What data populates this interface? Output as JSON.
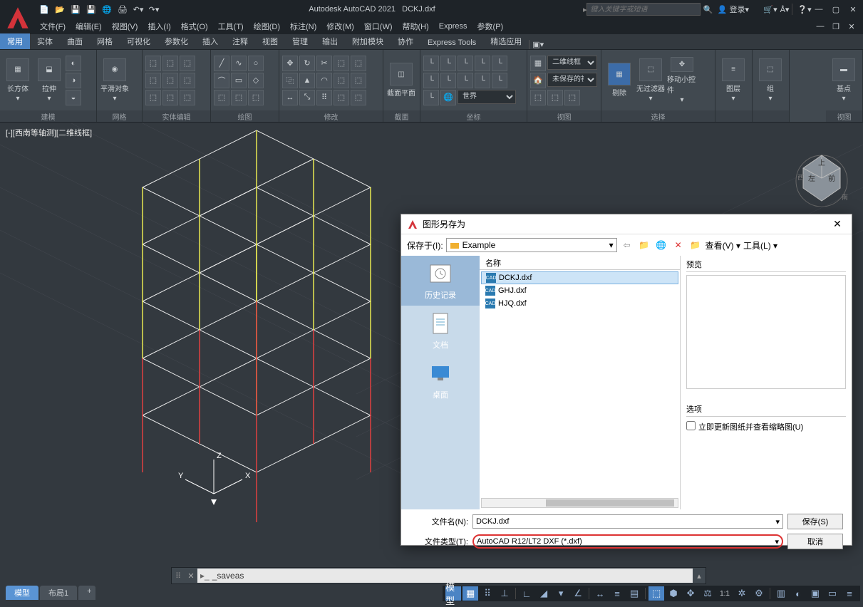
{
  "app": {
    "title_prefix": "Autodesk AutoCAD 2021",
    "document": "DCKJ.dxf",
    "search_placeholder": "键入关键字或短语",
    "login": "登录"
  },
  "menus": [
    "文件(F)",
    "编辑(E)",
    "视图(V)",
    "插入(I)",
    "格式(O)",
    "工具(T)",
    "绘图(D)",
    "标注(N)",
    "修改(M)",
    "窗口(W)",
    "帮助(H)",
    "Express",
    "参数(P)"
  ],
  "ribbon_tabs": [
    "常用",
    "实体",
    "曲面",
    "网格",
    "可视化",
    "参数化",
    "插入",
    "注释",
    "视图",
    "管理",
    "输出",
    "附加模块",
    "协作",
    "Express Tools",
    "精选应用"
  ],
  "ribbon_panels": {
    "p0": {
      "title": "建模",
      "btn0": "长方体",
      "btn1": "拉伸"
    },
    "p1": {
      "title": "网格",
      "btn0": "平滑对象"
    },
    "p2": {
      "title": "实体编辑"
    },
    "p3": {
      "title": "绘图"
    },
    "p4": {
      "title": "修改"
    },
    "p5": {
      "title": "截面",
      "btn0": "截面平面"
    },
    "p6": {
      "title": "坐标",
      "world": "世界"
    },
    "p7": {
      "title": "视图",
      "sel0": "二维线框",
      "sel1": "未保存的视图"
    },
    "p8": {
      "title": "选择",
      "btn0": "剔除",
      "btn1": "无过滤器",
      "btn2": "移动小控件"
    },
    "p9": {
      "btn": "图层"
    },
    "p10": {
      "btn": "组"
    },
    "p11": {
      "title": "视图",
      "btn": "基点"
    }
  },
  "viewport": {
    "label": "[-][西南等轴测][二维线框]",
    "axes": {
      "x": "X",
      "y": "Y",
      "z": "Z"
    },
    "cube": {
      "top": "上",
      "left": "左",
      "front": "前",
      "w": "西",
      "s": "南"
    }
  },
  "command": {
    "text": "_saveas"
  },
  "bottom_tabs": {
    "model": "模型",
    "layout1": "布局1",
    "add": "+"
  },
  "statusbar": {
    "model": "模型",
    "ratio": "1:1"
  },
  "dialog": {
    "title": "图形另存为",
    "save_in_label": "保存于(I):",
    "save_in_value": "Example",
    "view_btn": "查看(V)",
    "tools_btn": "工具(L)",
    "sidebar": {
      "history": "历史记录",
      "docs": "文档",
      "desktop": "桌面"
    },
    "col_name": "名称",
    "files": [
      "DCKJ.dxf",
      "GHJ.dxf",
      "HJQ.dxf"
    ],
    "preview_label": "预览",
    "options_label": "选项",
    "update_thumb": "立即更新图纸并查看缩略图(U)",
    "filename_label": "文件名(N):",
    "filename_value": "DCKJ.dxf",
    "filetype_label": "文件类型(T):",
    "filetype_value": "AutoCAD R12/LT2 DXF (*.dxf)",
    "save_btn": "保存(S)",
    "cancel_btn": "取消"
  }
}
